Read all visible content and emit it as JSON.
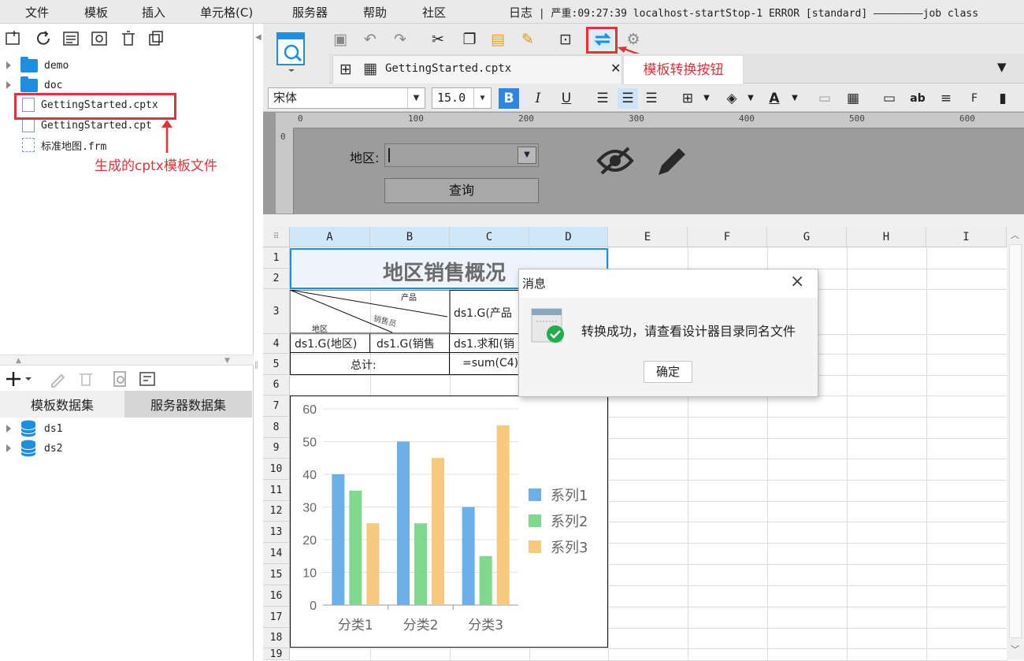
{
  "menu": [
    "文件",
    "模板",
    "插入",
    "单元格(C)",
    "服务器",
    "帮助",
    "社区"
  ],
  "log_label": "日志",
  "log_text": "严重:09:27:39 localhost-startStop-1 ERROR [standard] ————————job class",
  "tree": [
    {
      "label": "demo",
      "type": "folder"
    },
    {
      "label": "doc",
      "type": "folder"
    },
    {
      "label": "GettingStarted.cptx",
      "type": "file"
    },
    {
      "label": "GettingStarted.cpt",
      "type": "file"
    },
    {
      "label": "标准地图.frm",
      "type": "file"
    }
  ],
  "annotation_file": "生成的cptx模板文件",
  "annotation_button": "模板转换按钮",
  "dataset_tabs": [
    "模板数据集",
    "服务器数据集"
  ],
  "datasets": [
    "ds1",
    "ds2"
  ],
  "tab_label": "GettingStarted.cptx",
  "font_name": "宋体",
  "font_size": "15.0",
  "ruler_ticks": [
    "0",
    "100",
    "200",
    "300",
    "400",
    "500",
    "600"
  ],
  "param_label": "地区:",
  "query_button": "查询",
  "columns": [
    "A",
    "B",
    "C",
    "D",
    "E",
    "F",
    "G",
    "H",
    "I"
  ],
  "rows": [
    "1",
    "2",
    "3",
    "4",
    "5",
    "6",
    "7",
    "8",
    "9",
    "10",
    "11",
    "12",
    "13",
    "14",
    "15",
    "16",
    "17",
    "18",
    "19"
  ],
  "cells": {
    "title": "地区销售概况",
    "diag_product": "产品",
    "diag_sales": "销售员",
    "diag_region": "地区",
    "c3": "ds1.G(产品",
    "a4": "ds1.G(地区)",
    "b4": "ds1.G(销售",
    "c4": "ds1.求和(销",
    "total_label": "总计:",
    "c5": "=sum(C4)"
  },
  "dialog": {
    "title": "消息",
    "message": "转换成功，请查看设计器目录同名文件",
    "ok": "确定",
    "close": "×"
  },
  "chart_data": {
    "type": "bar",
    "categories": [
      "分类1",
      "分类2",
      "分类3"
    ],
    "series": [
      {
        "name": "系列1",
        "values": [
          40,
          50,
          30
        ],
        "color": "#6bb0e8"
      },
      {
        "name": "系列2",
        "values": [
          35,
          25,
          15
        ],
        "color": "#7ed98e"
      },
      {
        "name": "系列3",
        "values": [
          25,
          45,
          55
        ],
        "color": "#f7c97d"
      }
    ],
    "ylim": [
      0,
      60
    ],
    "yticks": [
      0,
      10,
      20,
      30,
      40,
      50,
      60
    ],
    "legend": "right",
    "grid": true
  }
}
